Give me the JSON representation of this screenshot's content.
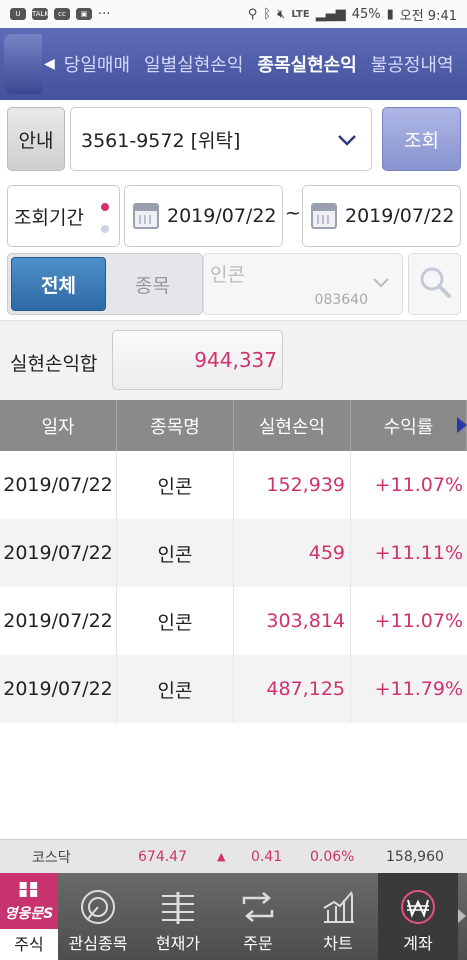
{
  "status_bar": {
    "battery": "45%",
    "time": "오전 9:41",
    "network": "LTE"
  },
  "top_nav": {
    "tabs": [
      {
        "label": "당일매매",
        "active": false
      },
      {
        "label": "일별실현손익",
        "active": false
      },
      {
        "label": "종목실현손익",
        "active": true
      },
      {
        "label": "불공정내역",
        "active": false
      }
    ]
  },
  "account": {
    "guide_label": "안내",
    "account_text": "3561-9572 [위탁]",
    "query_label": "조회"
  },
  "period": {
    "label": "조회기간",
    "start_date": "2019/07/22",
    "separator": "~",
    "end_date": "2019/07/22"
  },
  "filter": {
    "all_label": "전체",
    "stock_label": "종목",
    "stock_name": "인콘",
    "stock_code": "083640"
  },
  "total": {
    "label": "실현손익합",
    "value": "944,337"
  },
  "table": {
    "headers": [
      "일자",
      "종목명",
      "실현손익",
      "수익률"
    ],
    "rows": [
      {
        "date": "2019/07/22",
        "name": "인콘",
        "profit": "152,939",
        "rate": "+11.07%"
      },
      {
        "date": "2019/07/22",
        "name": "인콘",
        "profit": "459",
        "rate": "+11.11%"
      },
      {
        "date": "2019/07/22",
        "name": "인콘",
        "profit": "303,814",
        "rate": "+11.07%"
      },
      {
        "date": "2019/07/22",
        "name": "인콘",
        "profit": "487,125",
        "rate": "+11.79%"
      }
    ]
  },
  "ticker": {
    "name": "코스닥",
    "index": "674.47",
    "arrow": "▲",
    "change": "0.41",
    "change_pct": "0.06%",
    "volume": "158,960"
  },
  "bottom_nav": {
    "menu_logo": "영웅문S",
    "menu_label": "주식",
    "items": [
      {
        "label": "관심종목",
        "icon": "watchlist-icon"
      },
      {
        "label": "현재가",
        "icon": "current-price-icon"
      },
      {
        "label": "주문",
        "icon": "order-icon"
      },
      {
        "label": "차트",
        "icon": "chart-icon"
      },
      {
        "label": "계좌",
        "icon": "account-won-icon",
        "active": true
      }
    ]
  },
  "colors": {
    "accent_red": "#d0336b",
    "nav_blue": "#44519c",
    "active_blue": "#2d6aa5",
    "menu_pink": "#c8336f"
  }
}
